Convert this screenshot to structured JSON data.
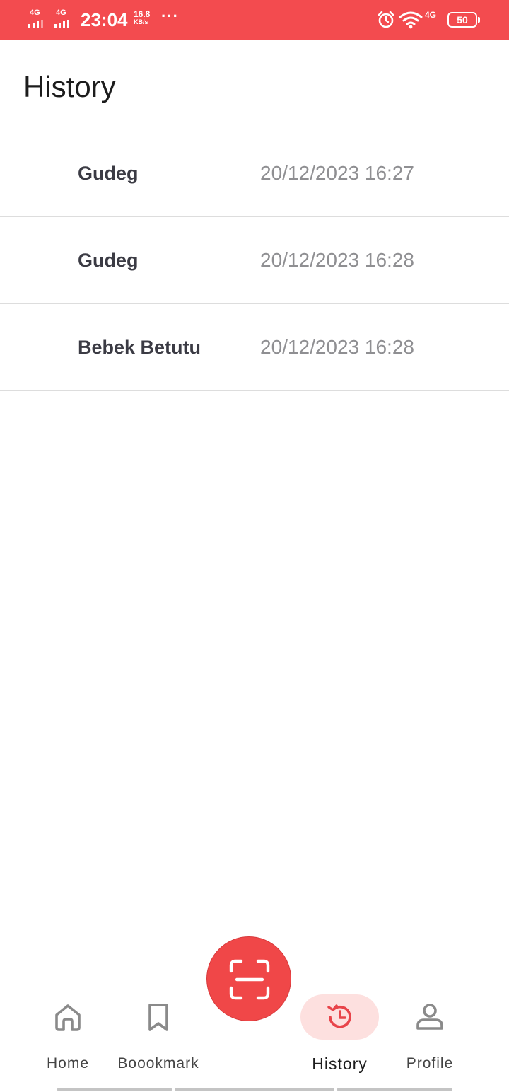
{
  "status_bar": {
    "network1": "4G",
    "network2": "4G",
    "time": "23:04",
    "speed_value": "16.8",
    "speed_unit": "KB/s",
    "overflow": "···",
    "network_right": "4G",
    "battery": "50",
    "icons": [
      "alarm-icon",
      "wifi-icon"
    ]
  },
  "page": {
    "title": "History"
  },
  "history": [
    {
      "name": "Gudeg",
      "datetime": "20/12/2023 16:27"
    },
    {
      "name": "Gudeg",
      "datetime": "20/12/2023 16:28"
    },
    {
      "name": "Bebek Betutu",
      "datetime": "20/12/2023 16:28"
    }
  ],
  "bottom_nav": {
    "items": [
      {
        "label": "Home",
        "icon": "home-icon",
        "active": false
      },
      {
        "label": "Boookmark",
        "icon": "bookmark-icon",
        "active": false
      },
      {
        "label": "History",
        "icon": "history-icon",
        "active": true
      },
      {
        "label": "Profile",
        "icon": "person-icon",
        "active": false
      }
    ],
    "fab_icon": "scan-icon"
  },
  "colors": {
    "primary": "#f34b4f",
    "active_pill": "#fde0df",
    "divider": "#dddddd",
    "name_text": "#3b3b44",
    "date_text": "#8f8f92"
  }
}
